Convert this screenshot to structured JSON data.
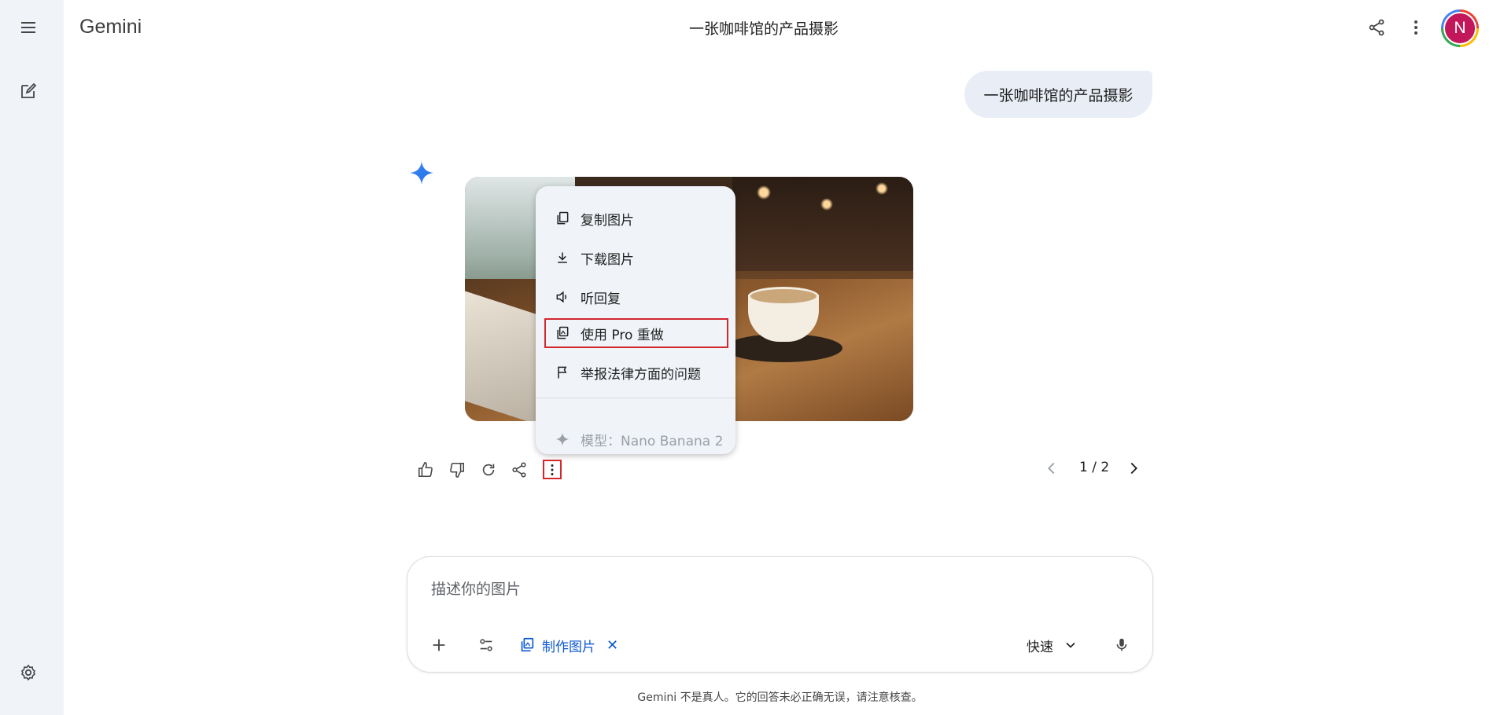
{
  "app": {
    "name": "Gemini"
  },
  "sidebar": {
    "menu_icon": "hamburger-menu-icon",
    "new_chat_icon": "edit-icon",
    "settings_icon": "gear-icon"
  },
  "header": {
    "title": "一张咖啡馆的产品摄影",
    "avatar_initial": "N"
  },
  "conversation": {
    "user_message": "一张咖啡馆的产品摄影"
  },
  "context_menu": {
    "items": [
      {
        "label": "复制图片",
        "icon": "copy-icon"
      },
      {
        "label": "下载图片",
        "icon": "download-icon"
      },
      {
        "label": "听回复",
        "icon": "speaker-icon"
      },
      {
        "label": "使用 Pro 重做",
        "icon": "redo-image-icon"
      },
      {
        "label": "举报法律方面的问题",
        "icon": "flag-icon"
      }
    ],
    "model_label": "模型：Nano Banana 2"
  },
  "response_actions": [
    "thumb-up-icon",
    "thumb-down-icon",
    "regenerate-icon",
    "share-icon",
    "more-vert-icon"
  ],
  "pager": {
    "text": "1 / 2"
  },
  "composer": {
    "placeholder": "描述你的图片",
    "chip_label": "制作图片",
    "chip_close": "✕",
    "mode_label": "快速"
  },
  "disclaimer": "Gemini 不是真人。它的回答未必正确无误，请注意核查。",
  "colors": {
    "sidebar_bg": "#f0f4f9",
    "accent_blue": "#0b57d0",
    "highlight_red": "#d3272e",
    "avatar_bg": "#c2185b",
    "bubble_bg": "#e9eef6"
  }
}
